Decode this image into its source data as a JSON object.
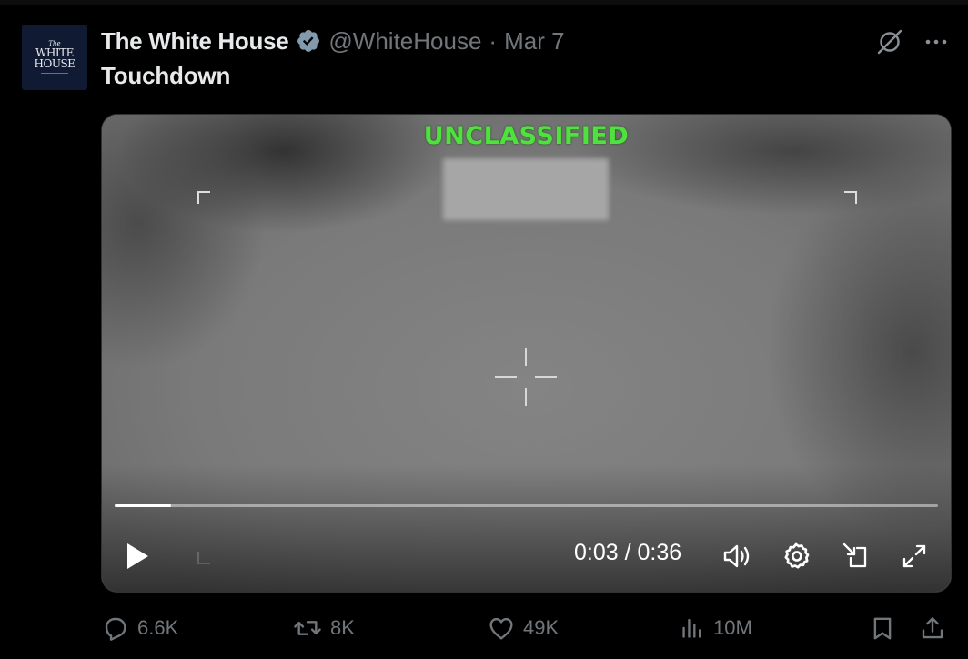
{
  "author": {
    "display_name": "The White House",
    "handle": "@WhiteHouse",
    "separator": "·",
    "date": "Mar 7",
    "verified": true,
    "avatar_text": {
      "line1": "The",
      "line2": "WHITE",
      "line3": "HOUSE"
    }
  },
  "tweet": {
    "text": "Touchdown"
  },
  "video": {
    "overlay_text": "UNCLASSIFIED",
    "current_time": "0:03",
    "separator": " / ",
    "duration": "0:36",
    "progress_fraction": 0.069,
    "state": "paused"
  },
  "icons": {
    "top": [
      "grok-icon",
      "more-icon"
    ],
    "controls": [
      "play-icon",
      "volume-icon",
      "settings-icon",
      "pip-icon",
      "fullscreen-icon"
    ],
    "actions": [
      "reply-icon",
      "retweet-icon",
      "like-icon",
      "views-icon",
      "bookmark-icon",
      "share-icon"
    ]
  },
  "stats": {
    "replies": "6.6K",
    "retweets": "8K",
    "likes": "49K",
    "views": "10M"
  },
  "colors": {
    "background": "#000000",
    "text_primary": "#e7e9ea",
    "text_secondary": "#71767b",
    "verified_badge": "#829aab",
    "overlay_green": "#4fe13d"
  }
}
